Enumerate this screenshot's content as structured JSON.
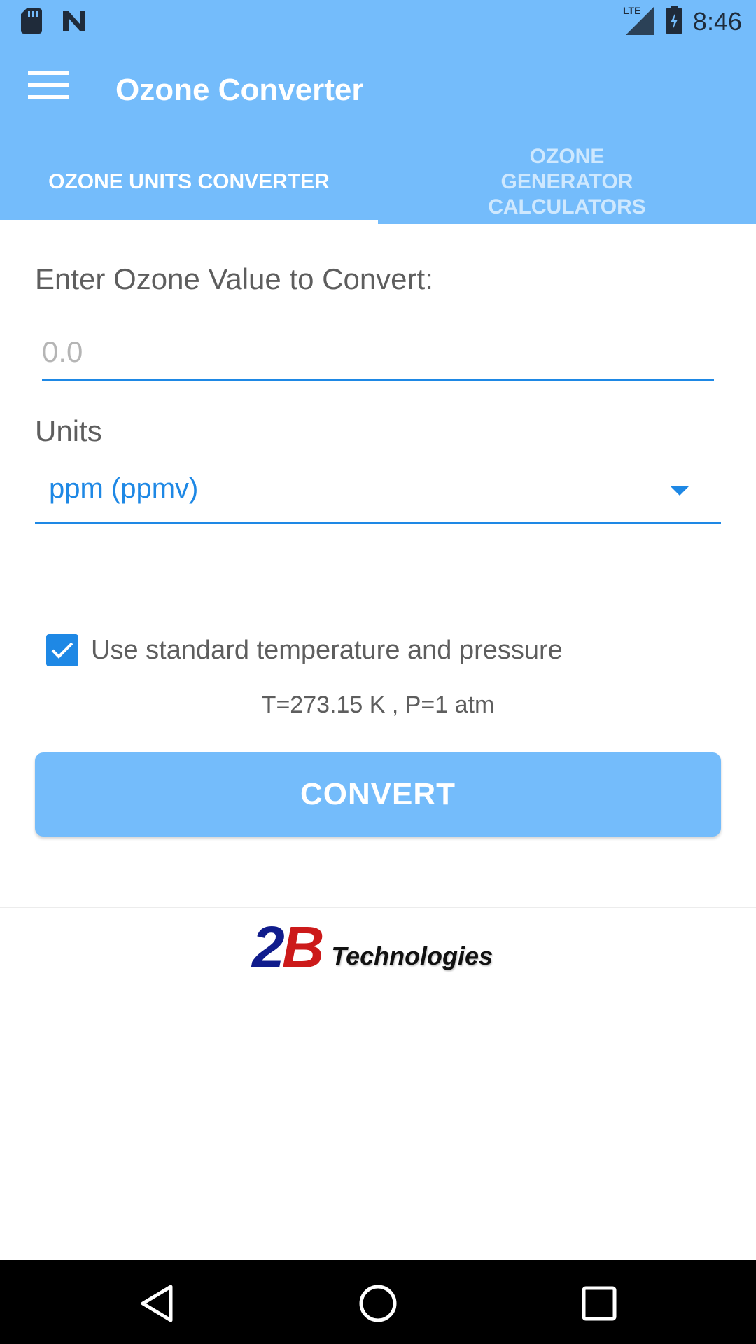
{
  "status_bar": {
    "time": "8:46",
    "network_label": "LTE",
    "left_icons": [
      "sd-card-icon",
      "n-notification-icon"
    ],
    "right_icons": [
      "lte-signal-icon",
      "battery-icon"
    ]
  },
  "toolbar": {
    "title": "Ozone Converter",
    "menu_icon": "hamburger-menu-icon"
  },
  "tabs": [
    {
      "label": "OZONE UNITS CONVERTER",
      "active": true
    },
    {
      "label": "OZONE GENERATOR CALCULATORS",
      "active": false
    }
  ],
  "form": {
    "value_label": "Enter Ozone Value to Convert:",
    "value_placeholder": "0.0",
    "units_label": "Units",
    "units_selected": "ppm (ppmv)",
    "stp_checkbox_label": "Use standard temperature and pressure",
    "stp_checked": true,
    "stp_values": "T=273.15 K , P=1 atm",
    "convert_label": "CONVERT"
  },
  "logo": {
    "mark_2": "2",
    "mark_b": "B",
    "text": "Technologies"
  },
  "nav_bar": {
    "icons": [
      "back-icon",
      "home-icon",
      "recents-icon"
    ]
  },
  "colors": {
    "primary": "#74BCFB",
    "accent": "#1E88E5",
    "text_secondary": "#5e5e5e",
    "logo_blue": "#101c8c",
    "logo_red": "#cc1a1a"
  }
}
